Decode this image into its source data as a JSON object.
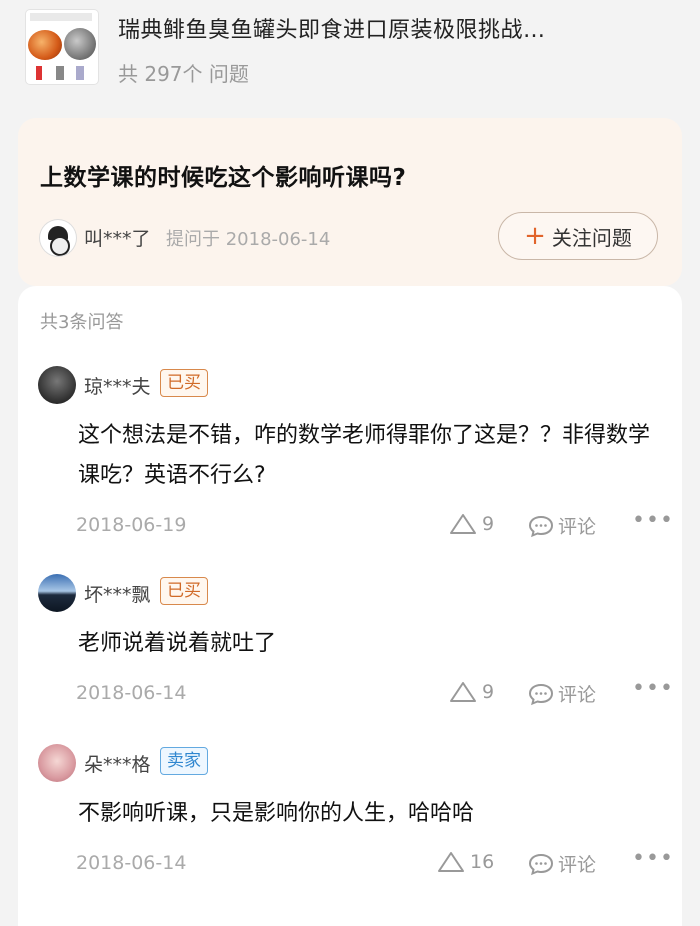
{
  "product": {
    "title": "瑞典鲱鱼臭鱼罐头即食进口原装极限挑战…",
    "question_count": "共 297个 问题"
  },
  "question": {
    "title": "上数学课的时候吃这个影响听课吗?",
    "asker": "叫***了",
    "asked_meta": "提问于 2018-06-14",
    "follow_label": "关注问题"
  },
  "answers_header": "共3条问答",
  "answers": [
    {
      "name": "琼***夫",
      "tag": "已买",
      "text": "这个想法是不错，咋的数学老师得罪你了这是？？非得数学课吃？英语不行么?",
      "date": "2018-06-19",
      "likes": "9",
      "comment_label": "评论"
    },
    {
      "name": "坏***飘",
      "tag": "已买",
      "text": "老师说着说着就吐了",
      "date": "2018-06-14",
      "likes": "9",
      "comment_label": "评论"
    },
    {
      "name": "朵***格",
      "tag": "卖家",
      "text": "不影响听课，只是影响你的人生，哈哈哈",
      "date": "2018-06-14",
      "likes": "16",
      "comment_label": "评论"
    }
  ],
  "icons": {
    "like": "triangle-up-icon",
    "comment": "chat-bubble-icon",
    "more": "more-dots-icon"
  },
  "colors": {
    "accent": "#e1642b",
    "bought_tag": "#d06a28",
    "seller_tag": "#2f86cf",
    "question_card_bg": "#fcf4ed"
  }
}
